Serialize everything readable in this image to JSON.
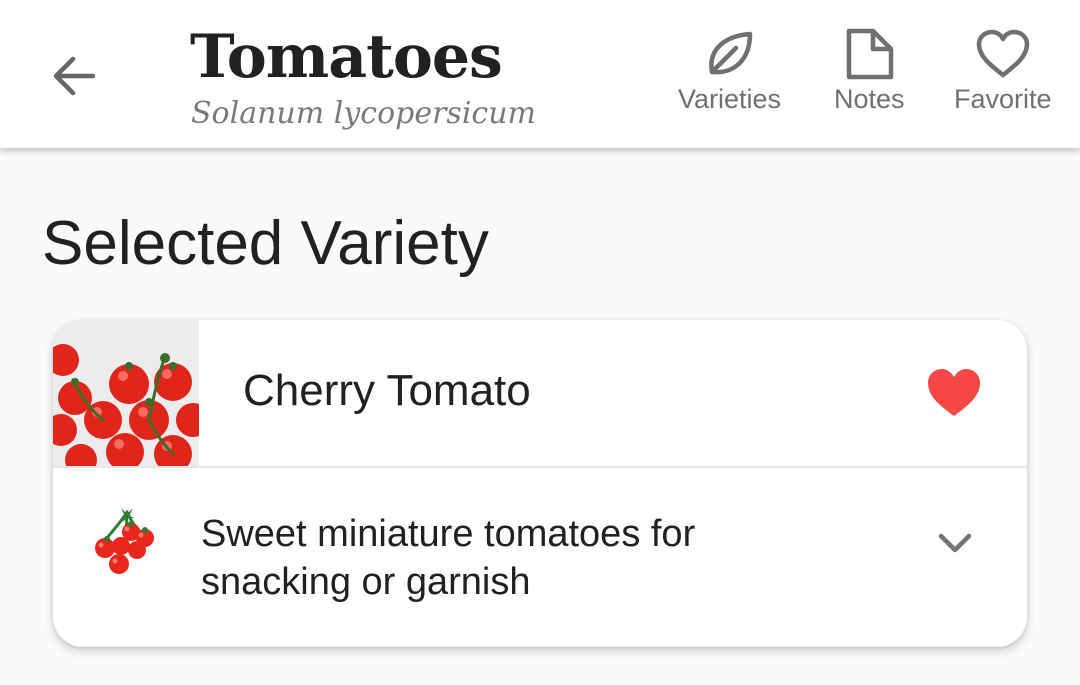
{
  "header": {
    "title": "Tomatoes",
    "subtitle": "Solanum lycopersicum",
    "back_icon": "arrow-left-icon",
    "actions": [
      {
        "label": "Varieties",
        "icon": "leaf-icon"
      },
      {
        "label": "Notes",
        "icon": "note-icon"
      },
      {
        "label": "Favorite",
        "icon": "heart-outline-icon"
      }
    ]
  },
  "section": {
    "heading": "Selected Variety"
  },
  "variety": {
    "name": "Cherry Tomato",
    "description": "Sweet miniature tomatoes for snacking or garnish",
    "favorited": true,
    "thumbnail_icon": "cherry-tomatoes-photo",
    "description_icon": "cherry-tomato-cluster-icon",
    "expand_icon": "chevron-down-icon"
  },
  "colors": {
    "favorite_heart": "#f44747",
    "icon_gray": "#707070",
    "tomato_red": "#e8261b"
  }
}
